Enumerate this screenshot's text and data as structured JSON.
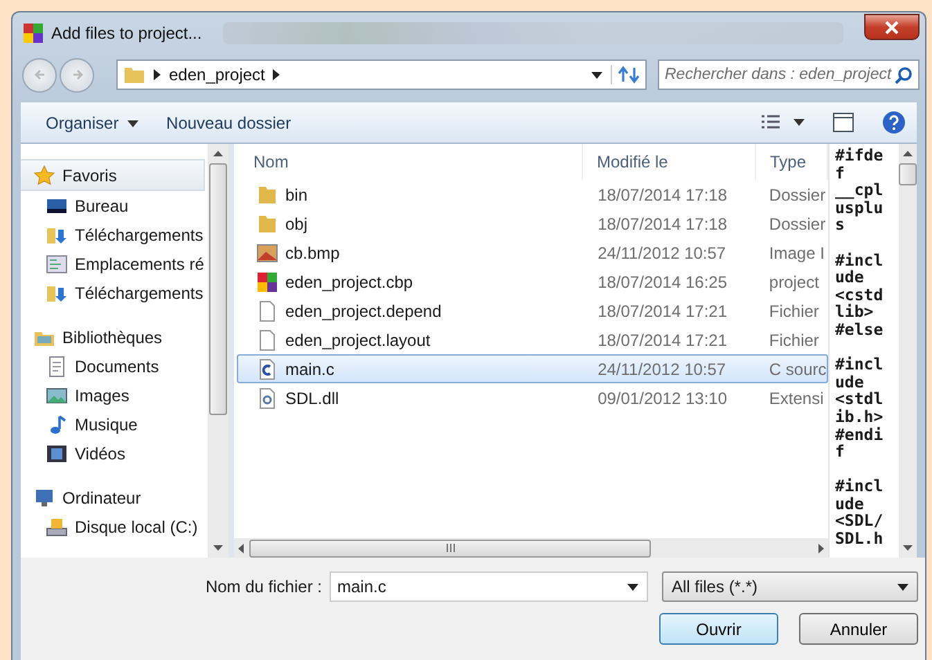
{
  "window": {
    "title": "Add files to project..."
  },
  "address_bar": {
    "path": "eden_project"
  },
  "search": {
    "placeholder": "Rechercher dans : eden_project"
  },
  "toolbar": {
    "organize": "Organiser",
    "new_folder": "Nouveau dossier"
  },
  "sidebar": {
    "groups": [
      {
        "label": "Favoris",
        "kind": "favorites",
        "selected": true,
        "children": [
          {
            "label": "Bureau",
            "kind": "desktop"
          },
          {
            "label": "Téléchargements",
            "kind": "download"
          },
          {
            "label": "Emplacements ré",
            "kind": "places"
          },
          {
            "label": "Téléchargements",
            "kind": "download"
          }
        ]
      },
      {
        "label": "Bibliothèques",
        "kind": "libraries",
        "selected": false,
        "children": [
          {
            "label": "Documents",
            "kind": "documents"
          },
          {
            "label": "Images",
            "kind": "images"
          },
          {
            "label": "Musique",
            "kind": "music"
          },
          {
            "label": "Vidéos",
            "kind": "videos"
          }
        ]
      },
      {
        "label": "Ordinateur",
        "kind": "computer",
        "selected": false,
        "children": [
          {
            "label": "Disque local (C:)",
            "kind": "disk"
          }
        ]
      }
    ]
  },
  "table": {
    "columns": [
      "Nom",
      "Modifié le",
      "Type"
    ],
    "rows": [
      {
        "name": "bin",
        "modified": "18/07/2014 17:18",
        "type": "Dossier",
        "kind": "folder",
        "selected": false
      },
      {
        "name": "obj",
        "modified": "18/07/2014 17:18",
        "type": "Dossier",
        "kind": "folder",
        "selected": false
      },
      {
        "name": "cb.bmp",
        "modified": "24/11/2012 10:57",
        "type": "Image I",
        "kind": "image",
        "selected": false
      },
      {
        "name": "eden_project.cbp",
        "modified": "18/07/2014 16:25",
        "type": "project",
        "kind": "project",
        "selected": false
      },
      {
        "name": "eden_project.depend",
        "modified": "18/07/2014 17:21",
        "type": "Fichier",
        "kind": "file",
        "selected": false
      },
      {
        "name": "eden_project.layout",
        "modified": "18/07/2014 17:21",
        "type": "Fichier",
        "kind": "file",
        "selected": false
      },
      {
        "name": "main.c",
        "modified": "24/11/2012 10:57",
        "type": "C sourc",
        "kind": "c-source",
        "selected": true
      },
      {
        "name": "SDL.dll",
        "modified": "09/01/2012 13:10",
        "type": "Extensi",
        "kind": "dll",
        "selected": false
      }
    ]
  },
  "preview": {
    "blocks": [
      [
        "#ifde",
        "f",
        "__cpl",
        "usplu",
        "s"
      ],
      [
        "#incl",
        "ude",
        "<cstd",
        "lib>",
        "#else"
      ],
      [
        "#incl",
        "ude",
        "<stdl",
        "ib.h>",
        "#endi",
        "f"
      ],
      [
        "#incl",
        "ude",
        "<SDL/",
        "SDL.h"
      ]
    ]
  },
  "filename": {
    "label": "Nom du fichier :",
    "value": "main.c"
  },
  "filter": {
    "value": "All files (*.*)"
  },
  "buttons": [
    {
      "label": "Ouvrir",
      "default": true
    },
    {
      "label": "Annuler",
      "default": false
    }
  ]
}
